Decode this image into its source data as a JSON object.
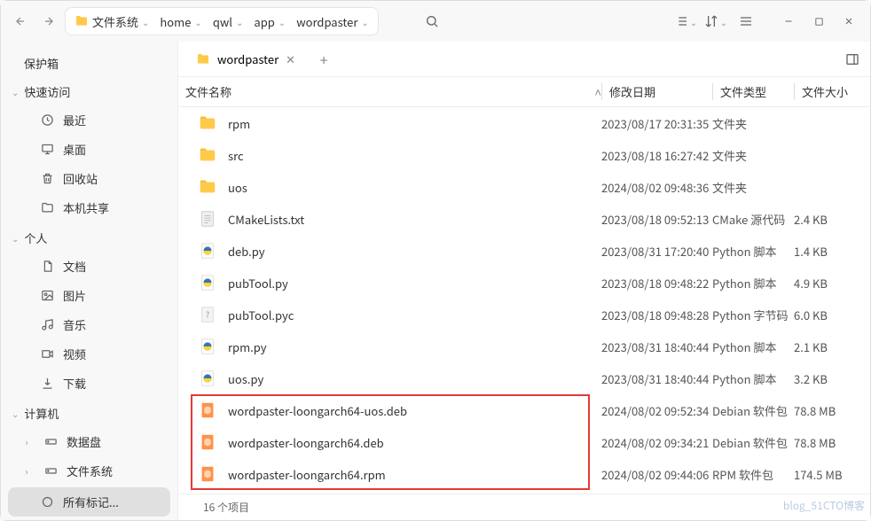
{
  "breadcrumb": {
    "root_label": "文件系统",
    "segments": [
      "home",
      "qwl",
      "app",
      "wordpaster"
    ]
  },
  "sidebar": {
    "vault": "保护箱",
    "quick": {
      "title": "快速访问",
      "items": [
        {
          "icon": "clock",
          "label": "最近"
        },
        {
          "icon": "desktop",
          "label": "桌面"
        },
        {
          "icon": "trash",
          "label": "回收站"
        },
        {
          "icon": "folder",
          "label": "本机共享"
        }
      ]
    },
    "personal": {
      "title": "个人",
      "items": [
        {
          "icon": "doc",
          "label": "文档"
        },
        {
          "icon": "image",
          "label": "图片"
        },
        {
          "icon": "music",
          "label": "音乐"
        },
        {
          "icon": "video",
          "label": "视频"
        },
        {
          "icon": "download",
          "label": "下载"
        }
      ]
    },
    "computer": {
      "title": "计算机",
      "items": [
        {
          "icon": "disk",
          "label": "数据盘"
        },
        {
          "icon": "disk",
          "label": "文件系统"
        }
      ]
    },
    "tags": {
      "label": "所有标记..."
    }
  },
  "tab": {
    "label": "wordpaster"
  },
  "columns": {
    "name": "文件名称",
    "date": "修改日期",
    "type": "文件类型",
    "size": "文件大小"
  },
  "files": [
    {
      "icon": "folder",
      "name": "rpm",
      "date": "2023/08/17 20:31:35",
      "type": "文件夹",
      "size": ""
    },
    {
      "icon": "folder",
      "name": "src",
      "date": "2023/08/18 16:27:42",
      "type": "文件夹",
      "size": ""
    },
    {
      "icon": "folder",
      "name": "uos",
      "date": "2024/08/02 09:48:36",
      "type": "文件夹",
      "size": ""
    },
    {
      "icon": "text",
      "name": "CMakeLists.txt",
      "date": "2023/08/18 09:52:13",
      "type": "CMake 源代码",
      "size": "2.4 KB"
    },
    {
      "icon": "py",
      "name": "deb.py",
      "date": "2023/08/31 17:20:40",
      "type": "Python 脚本",
      "size": "1.4 KB"
    },
    {
      "icon": "py",
      "name": "pubTool.py",
      "date": "2023/08/18 09:48:22",
      "type": "Python 脚本",
      "size": "4.9 KB"
    },
    {
      "icon": "pyc",
      "name": "pubTool.pyc",
      "date": "2023/08/18 09:48:28",
      "type": "Python 字节码",
      "size": "6.0 KB"
    },
    {
      "icon": "py",
      "name": "rpm.py",
      "date": "2023/08/31 18:40:44",
      "type": "Python 脚本",
      "size": "2.1 KB"
    },
    {
      "icon": "py",
      "name": "uos.py",
      "date": "2023/08/31 18:40:44",
      "type": "Python 脚本",
      "size": "3.2 KB"
    },
    {
      "icon": "deb",
      "name": "wordpaster-loongarch64-uos.deb",
      "date": "2024/08/02 09:52:34",
      "type": "Debian 软件包",
      "size": "78.8 MB"
    },
    {
      "icon": "deb",
      "name": "wordpaster-loongarch64.deb",
      "date": "2024/08/02 09:34:21",
      "type": "Debian 软件包",
      "size": "78.8 MB"
    },
    {
      "icon": "rpm",
      "name": "wordpaster-loongarch64.rpm",
      "date": "2024/08/02 09:44:06",
      "type": "RPM 软件包",
      "size": "174.5 MB"
    }
  ],
  "status": "16 个项目",
  "watermark": "blog_51CTO博客"
}
